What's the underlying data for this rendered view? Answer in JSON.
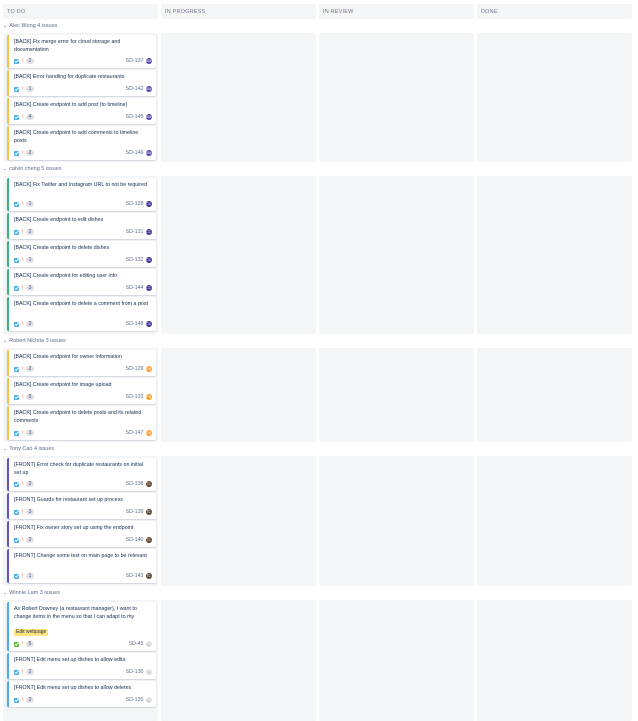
{
  "columns": [
    {
      "label": "TO DO"
    },
    {
      "label": "IN PROGRESS"
    },
    {
      "label": "IN REVIEW"
    },
    {
      "label": "DONE"
    }
  ],
  "swimlanes": [
    {
      "title": "Alec Wong 4 issues",
      "assignee_initials": "AW",
      "cards": [
        {
          "summary": "[BACK] Fix merge error for cloud storage and documentation",
          "type": "task",
          "points": "2",
          "key": "SD-137"
        },
        {
          "summary": "[BACK] Error handling for duplicate restaurants",
          "type": "task",
          "points": "1",
          "key": "SD-142"
        },
        {
          "summary": "[BACK] Create endpoint to add post (to timeline)",
          "type": "task",
          "points": "4",
          "key": "SD-145"
        },
        {
          "summary": "[BACK] Create endpoint to add comments to timeline posts",
          "type": "task",
          "points": "2",
          "key": "SD-146"
        }
      ]
    },
    {
      "title": "calvin cheng 5 issues",
      "assignee_initials": "CC",
      "cards": [
        {
          "summary": "[BACK] Fix Twitter and Instagram URL to not be required",
          "type": "task",
          "points": "1",
          "key": "SD-128"
        },
        {
          "summary": "[BACK] Create endpoint to edit dishes",
          "type": "task",
          "points": "2",
          "key": "SD-131"
        },
        {
          "summary": "[BACK] Create endpoint to delete dishes",
          "type": "task",
          "points": "1",
          "key": "SD-132"
        },
        {
          "summary": "[BACK] Create endpoint for editing user info",
          "type": "task",
          "points": "3",
          "key": "SD-144"
        },
        {
          "summary": "[BACK] Create endpoint to delete a comment from a post",
          "type": "task",
          "points": "2",
          "key": "SD-148"
        }
      ]
    },
    {
      "title": "Robert Nichita 3 issues",
      "assignee_initials": "RN",
      "cards": [
        {
          "summary": "[BACK] Create endpoint for owner information",
          "type": "task",
          "points": "2",
          "key": "SD-129"
        },
        {
          "summary": "[BACK] Create endpoint for image upload",
          "type": "task",
          "points": "5",
          "key": "SD-133"
        },
        {
          "summary": "[BACK] Create endpoint to delete posts and its related comments",
          "type": "task",
          "points": "3",
          "key": "SD-147"
        }
      ]
    },
    {
      "title": "Tony Cao 4 issues",
      "assignee_initials": "TC",
      "cards": [
        {
          "summary": "[FRONT] Error check for duplicate restaurants on initial set up",
          "type": "task",
          "points": "2",
          "key": "SD-138"
        },
        {
          "summary": "[FRONT] Guards for restaurant set up process",
          "type": "task",
          "points": "3",
          "key": "SD-139"
        },
        {
          "summary": "[FRONT] Fix owner story set up using the endpoint",
          "type": "task",
          "points": "2",
          "key": "SD-140"
        },
        {
          "summary": "[FRONT] Change some text on main page to be relevant",
          "type": "task",
          "points": "1",
          "key": "SD-143"
        }
      ]
    },
    {
      "title": "Winnie Lam 3 issues",
      "assignee_initials": "WL",
      "cards": [
        {
          "summary": "As Robert Downey (a restaurant manager), I want to change items in the menu so that I can adapt to my",
          "type": "story",
          "points": "5",
          "key": "SD-45",
          "epic": "Edit webpage"
        },
        {
          "summary": "[FRONT] Edit menu set up dishes to allow edits",
          "type": "task",
          "points": "2",
          "key": "SD-130"
        },
        {
          "summary": "[FRONT] Edit menu set up dishes to allow deletes",
          "type": "task",
          "points": "2",
          "key": "SD-135"
        }
      ]
    }
  ],
  "colors": {
    "column_bg": "#f4f5f7",
    "task_icon": "#4bade8",
    "story_icon": "#63ba3c",
    "priority": "#ff5630",
    "epic_label": "#ffe380"
  }
}
